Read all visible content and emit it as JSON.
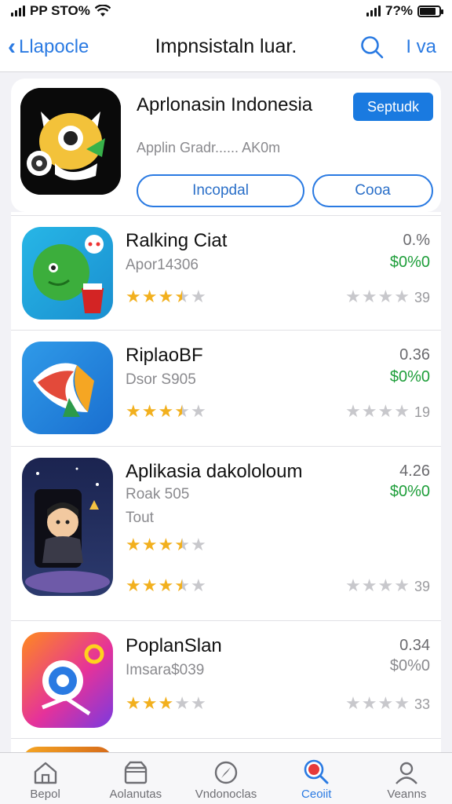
{
  "status_bar": {
    "left_text": "PP STO%",
    "right_text": "7?%",
    "battery_level": 0.85
  },
  "nav": {
    "back_label": "Llapocle",
    "title": "Impnsistaln luar.",
    "right_label": "I va",
    "search_icon": "search-icon"
  },
  "featured": {
    "title": "Aprlonasin Indonesia",
    "subtitle": "Applin Gradr......  AK0m",
    "top_button": "Septudk",
    "pill_1": "Incopdal",
    "pill_2": "Cooa"
  },
  "apps": [
    {
      "name": "Ralking Ciat",
      "sub": "Apor14306",
      "extra": "",
      "value": "0.%",
      "price": "$0%0",
      "count": "39",
      "rating": 3.5,
      "price_color": "green"
    },
    {
      "name": "RiplaoBF",
      "sub": "Dsor S905",
      "extra": "",
      "value": "0.36",
      "price": "$0%0",
      "count": "19",
      "rating": 3.5,
      "price_color": "green"
    },
    {
      "name": "Aplikasia dakololoum",
      "sub": "Roak  505",
      "extra": "Tout",
      "value": "4.26",
      "price": "$0%0",
      "count": "39",
      "rating": 3.5,
      "price_color": "green"
    },
    {
      "name": "PoplanSlan",
      "sub": "Imsara$039",
      "extra": "",
      "value": "0.34",
      "price": "$0%0",
      "count": "33",
      "rating": 3.0,
      "price_color": "gray"
    }
  ],
  "tabs": [
    {
      "label": "Bepol",
      "icon": "home-icon",
      "active": false
    },
    {
      "label": "Aolanutas",
      "icon": "box-icon",
      "active": false
    },
    {
      "label": "Vndonoclas",
      "icon": "compass-icon",
      "active": false
    },
    {
      "label": "Ceoiit",
      "icon": "search-icon",
      "active": true
    },
    {
      "label": "Veanns",
      "icon": "person-icon",
      "active": false
    }
  ],
  "colors": {
    "accent": "#2a7ae2",
    "price_green": "#1e9e3a",
    "star": "#f2b01e"
  }
}
